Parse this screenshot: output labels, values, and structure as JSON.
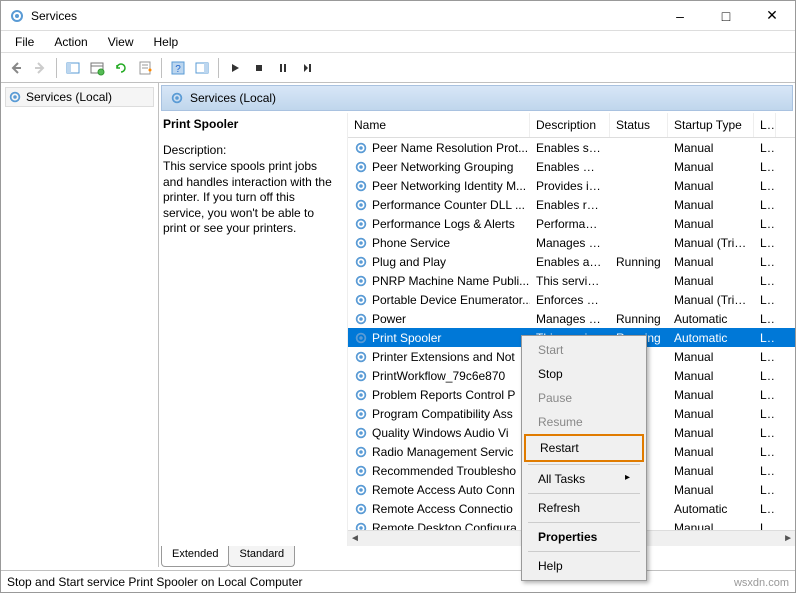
{
  "window": {
    "title": "Services"
  },
  "menu": [
    "File",
    "Action",
    "View",
    "Help"
  ],
  "tree": {
    "root": "Services (Local)"
  },
  "contentHeader": "Services (Local)",
  "detail": {
    "title": "Print Spooler",
    "descLabel": "Description:",
    "description": "This service spools print jobs and handles interaction with the printer. If you turn off this service, you won't be able to print or see your printers."
  },
  "columns": {
    "name": "Name",
    "desc": "Description",
    "status": "Status",
    "startup": "Startup Type",
    "logon": "Lo"
  },
  "rows": [
    {
      "name": "Peer Name Resolution Prot...",
      "desc": "Enables serv...",
      "status": "",
      "startup": "Manual",
      "logon": "Lc"
    },
    {
      "name": "Peer Networking Grouping",
      "desc": "Enables mul...",
      "status": "",
      "startup": "Manual",
      "logon": "Lc"
    },
    {
      "name": "Peer Networking Identity M...",
      "desc": "Provides ide...",
      "status": "",
      "startup": "Manual",
      "logon": "Lc"
    },
    {
      "name": "Performance Counter DLL ...",
      "desc": "Enables rem...",
      "status": "",
      "startup": "Manual",
      "logon": "Lc"
    },
    {
      "name": "Performance Logs & Alerts",
      "desc": "Performanc...",
      "status": "",
      "startup": "Manual",
      "logon": "Lc"
    },
    {
      "name": "Phone Service",
      "desc": "Manages th...",
      "status": "",
      "startup": "Manual (Trig...",
      "logon": "Lc"
    },
    {
      "name": "Plug and Play",
      "desc": "Enables a c...",
      "status": "Running",
      "startup": "Manual",
      "logon": "Lc"
    },
    {
      "name": "PNRP Machine Name Publi...",
      "desc": "This service ...",
      "status": "",
      "startup": "Manual",
      "logon": "Lc"
    },
    {
      "name": "Portable Device Enumerator...",
      "desc": "Enforces gr...",
      "status": "",
      "startup": "Manual (Trig...",
      "logon": "Lc"
    },
    {
      "name": "Power",
      "desc": "Manages p...",
      "status": "Running",
      "startup": "Automatic",
      "logon": "Lc"
    },
    {
      "name": "Print Spooler",
      "desc": "This service...",
      "status": "Running",
      "startup": "Automatic",
      "logon": "Lc",
      "selected": true
    },
    {
      "name": "Printer Extensions and Not",
      "desc": "",
      "status": "",
      "startup": "Manual",
      "logon": "Lc"
    },
    {
      "name": "PrintWorkflow_79c6e870",
      "desc": "",
      "status": "",
      "startup": "Manual",
      "logon": "Lc"
    },
    {
      "name": "Problem Reports Control P",
      "desc": "",
      "status": "",
      "startup": "Manual",
      "logon": "Lc"
    },
    {
      "name": "Program Compatibility Ass",
      "desc": "",
      "status": "g",
      "startup": "Manual",
      "logon": "Lc"
    },
    {
      "name": "Quality Windows Audio Vi",
      "desc": "",
      "status": "g",
      "startup": "Manual",
      "logon": "Lc"
    },
    {
      "name": "Radio Management Servic",
      "desc": "",
      "status": "",
      "startup": "Manual",
      "logon": "Lc"
    },
    {
      "name": "Recommended Troublesho",
      "desc": "",
      "status": "",
      "startup": "Manual",
      "logon": "Lc"
    },
    {
      "name": "Remote Access Auto Conn",
      "desc": "",
      "status": "",
      "startup": "Manual",
      "logon": "Lc"
    },
    {
      "name": "Remote Access Connectio",
      "desc": "",
      "status": "g",
      "startup": "Automatic",
      "logon": "Lc"
    },
    {
      "name": "Remote Desktop Configura",
      "desc": "",
      "status": "",
      "startup": "Manual",
      "logon": "Lc"
    }
  ],
  "tabs": {
    "extended": "Extended",
    "standard": "Standard"
  },
  "context": {
    "start": "Start",
    "stop": "Stop",
    "pause": "Pause",
    "resume": "Resume",
    "restart": "Restart",
    "alltasks": "All Tasks",
    "refresh": "Refresh",
    "properties": "Properties",
    "help": "Help"
  },
  "statusbar": "Stop and Start service Print Spooler on Local Computer",
  "watermark": "wsxdn.com"
}
